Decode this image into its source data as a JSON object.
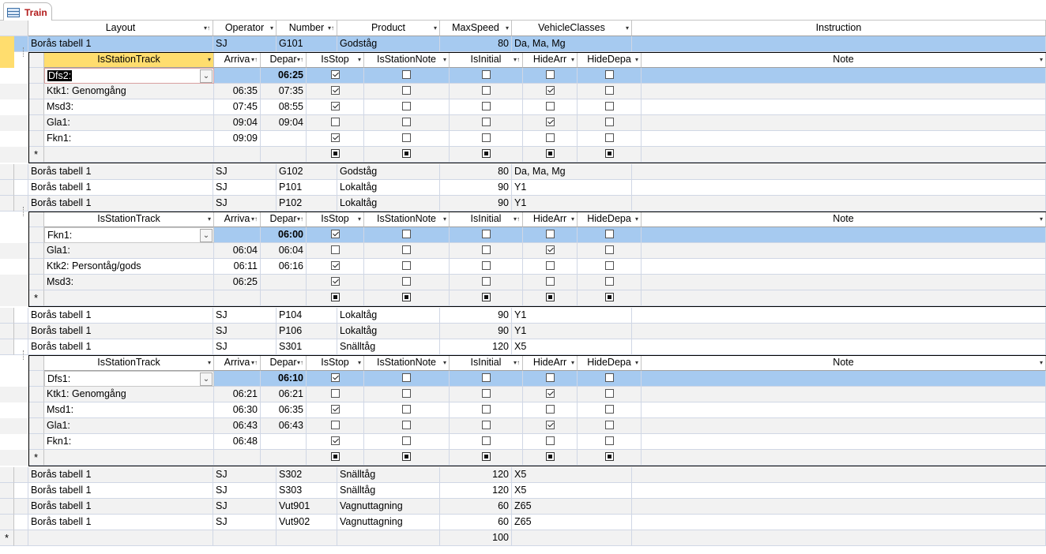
{
  "tab": {
    "title": "Train"
  },
  "main_columns": [
    "Layout",
    "Operator",
    "Number",
    "Product",
    "MaxSpeed",
    "VehicleClasses",
    "Instruction"
  ],
  "sub_columns": [
    "IsStationTrack",
    "Arriva",
    "Depar",
    "IsStop",
    "IsStationNote",
    "IsInitial",
    "HideArr",
    "HideDepa",
    "Note"
  ],
  "trains": [
    {
      "layout": "Borås tabell 1",
      "operator": "SJ",
      "number": "G101",
      "product": "Godståg",
      "maxspeed": "80",
      "vehicle": "Da, Ma, Mg",
      "expanded": true,
      "stations": [
        {
          "track": "Dfs2:",
          "arr": "",
          "dep": "06:25",
          "stop": true,
          "note": false,
          "init": false,
          "hidearr": false,
          "hidedep": false
        },
        {
          "track": "Ktk1: Genomgång",
          "arr": "06:35",
          "dep": "07:35",
          "stop": true,
          "note": false,
          "init": false,
          "hidearr": true,
          "hidedep": false
        },
        {
          "track": "Msd3:",
          "arr": "07:45",
          "dep": "08:55",
          "stop": true,
          "note": false,
          "init": false,
          "hidearr": false,
          "hidedep": false
        },
        {
          "track": "Gla1:",
          "arr": "09:04",
          "dep": "09:04",
          "stop": false,
          "note": false,
          "init": false,
          "hidearr": true,
          "hidedep": false
        },
        {
          "track": "Fkn1:",
          "arr": "09:09",
          "dep": "",
          "stop": true,
          "note": false,
          "init": false,
          "hidearr": false,
          "hidedep": false
        }
      ]
    },
    {
      "layout": "Borås tabell 1",
      "operator": "SJ",
      "number": "G102",
      "product": "Godståg",
      "maxspeed": "80",
      "vehicle": "Da, Ma, Mg",
      "expanded": false
    },
    {
      "layout": "Borås tabell 1",
      "operator": "SJ",
      "number": "P101",
      "product": "Lokaltåg",
      "maxspeed": "90",
      "vehicle": "Y1",
      "expanded": false
    },
    {
      "layout": "Borås tabell 1",
      "operator": "SJ",
      "number": "P102",
      "product": "Lokaltåg",
      "maxspeed": "90",
      "vehicle": "Y1",
      "expanded": true,
      "stations": [
        {
          "track": "Fkn1:",
          "arr": "",
          "dep": "06:00",
          "stop": true,
          "note": false,
          "init": false,
          "hidearr": false,
          "hidedep": false
        },
        {
          "track": "Gla1:",
          "arr": "06:04",
          "dep": "06:04",
          "stop": false,
          "note": false,
          "init": false,
          "hidearr": true,
          "hidedep": false
        },
        {
          "track": "Ktk2: Persontåg/gods",
          "arr": "06:11",
          "dep": "06:16",
          "stop": true,
          "note": false,
          "init": false,
          "hidearr": false,
          "hidedep": false
        },
        {
          "track": "Msd3:",
          "arr": "06:25",
          "dep": "",
          "stop": true,
          "note": false,
          "init": false,
          "hidearr": false,
          "hidedep": false
        }
      ]
    },
    {
      "layout": "Borås tabell 1",
      "operator": "SJ",
      "number": "P104",
      "product": "Lokaltåg",
      "maxspeed": "90",
      "vehicle": "Y1",
      "expanded": false
    },
    {
      "layout": "Borås tabell 1",
      "operator": "SJ",
      "number": "P106",
      "product": "Lokaltåg",
      "maxspeed": "90",
      "vehicle": "Y1",
      "expanded": false
    },
    {
      "layout": "Borås tabell 1",
      "operator": "SJ",
      "number": "S301",
      "product": "Snälltåg",
      "maxspeed": "120",
      "vehicle": "X5",
      "expanded": true,
      "stations": [
        {
          "track": "Dfs1:",
          "arr": "",
          "dep": "06:10",
          "stop": true,
          "note": false,
          "init": false,
          "hidearr": false,
          "hidedep": false
        },
        {
          "track": "Ktk1: Genomgång",
          "arr": "06:21",
          "dep": "06:21",
          "stop": false,
          "note": false,
          "init": false,
          "hidearr": true,
          "hidedep": false
        },
        {
          "track": "Msd1:",
          "arr": "06:30",
          "dep": "06:35",
          "stop": true,
          "note": false,
          "init": false,
          "hidearr": false,
          "hidedep": false
        },
        {
          "track": "Gla1:",
          "arr": "06:43",
          "dep": "06:43",
          "stop": false,
          "note": false,
          "init": false,
          "hidearr": true,
          "hidedep": false
        },
        {
          "track": "Fkn1:",
          "arr": "06:48",
          "dep": "",
          "stop": true,
          "note": false,
          "init": false,
          "hidearr": false,
          "hidedep": false
        }
      ]
    },
    {
      "layout": "Borås tabell 1",
      "operator": "SJ",
      "number": "S302",
      "product": "Snälltåg",
      "maxspeed": "120",
      "vehicle": "X5",
      "expanded": false
    },
    {
      "layout": "Borås tabell 1",
      "operator": "SJ",
      "number": "S303",
      "product": "Snälltåg",
      "maxspeed": "120",
      "vehicle": "X5",
      "expanded": false
    },
    {
      "layout": "Borås tabell 1",
      "operator": "SJ",
      "number": "Vut901",
      "product": "Vagnuttagning",
      "maxspeed": "60",
      "vehicle": "Z65",
      "expanded": false
    },
    {
      "layout": "Borås tabell 1",
      "operator": "SJ",
      "number": "Vut902",
      "product": "Vagnuttagning",
      "maxspeed": "60",
      "vehicle": "Z65",
      "expanded": false
    }
  ],
  "new_row": {
    "maxspeed": "100"
  },
  "new_record_symbol": "*",
  "icons": {
    "expand": "plus-box",
    "collapse": "minus-box",
    "dropdown": "chevron-down",
    "sort": "sort-arrow",
    "filter": "filter-arrow"
  }
}
